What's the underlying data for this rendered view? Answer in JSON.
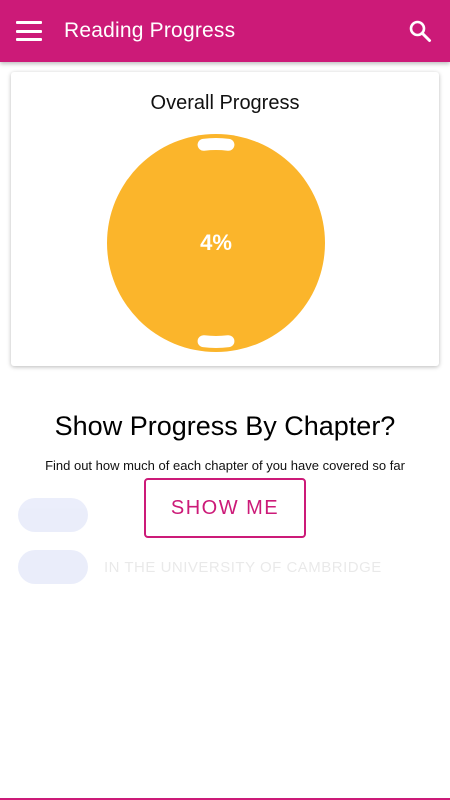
{
  "appbar": {
    "title": "Reading Progress",
    "menu_icon": "menu-icon",
    "search_icon": "search-icon",
    "color": "#cc1a78"
  },
  "overall": {
    "title": "Overall Progress",
    "percent_label": "4%",
    "progress_fraction": 0.04,
    "ring_color": "#fbb52b",
    "progress_color": "#ffffff"
  },
  "faded_list": {
    "rows": [
      {
        "text": "IN THE UNIVERSITY OF CAMBRIDGE"
      }
    ]
  },
  "tip": {
    "title": "Show Progress By Chapter?",
    "subtitle": "Find out how much of each chapter of you have covered so far",
    "button_label": "SHOW ME"
  }
}
